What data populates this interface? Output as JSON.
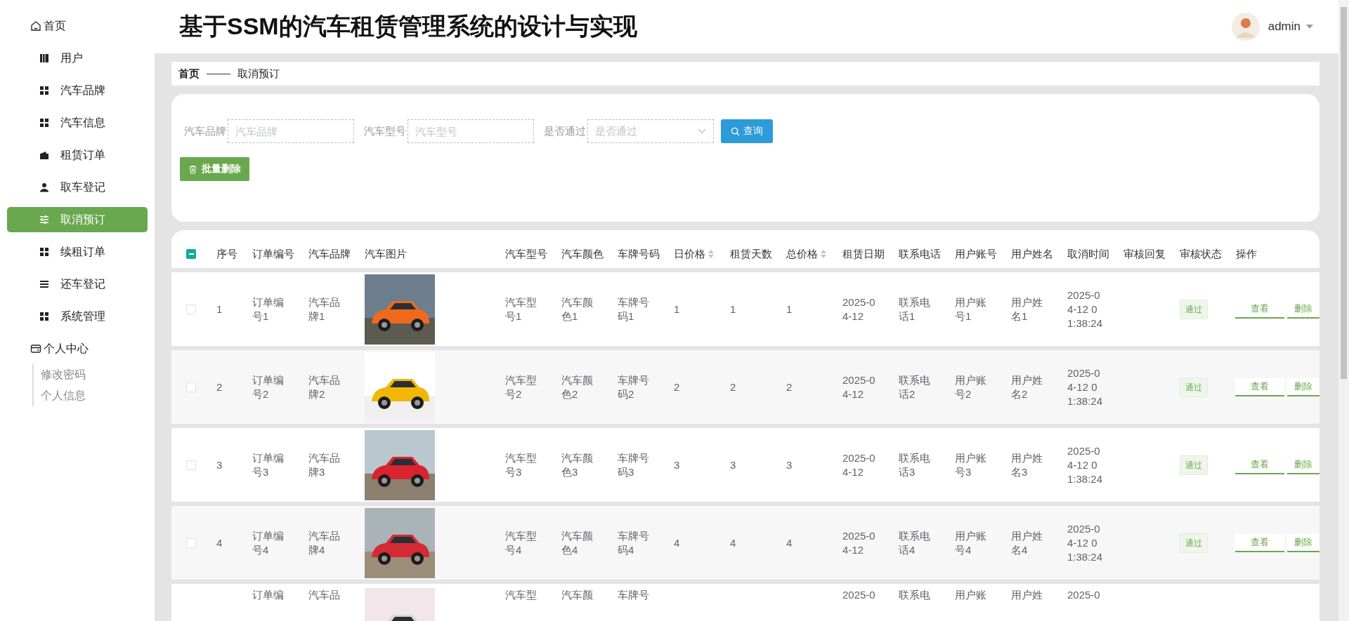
{
  "sidebar": {
    "items": [
      {
        "label": "首页",
        "kind": "top",
        "selected": false
      },
      {
        "label": "用户",
        "kind": "item",
        "selected": false
      },
      {
        "label": "汽车品牌",
        "kind": "item",
        "selected": false
      },
      {
        "label": "汽车信息",
        "kind": "item",
        "selected": false
      },
      {
        "label": "租赁订单",
        "kind": "item",
        "selected": false
      },
      {
        "label": "取车登记",
        "kind": "item",
        "selected": false
      },
      {
        "label": "取消预订",
        "kind": "item",
        "selected": true
      },
      {
        "label": "续租订单",
        "kind": "item",
        "selected": false
      },
      {
        "label": "还车登记",
        "kind": "item",
        "selected": false
      },
      {
        "label": "系统管理",
        "kind": "item",
        "selected": false
      },
      {
        "label": "个人中心",
        "kind": "top",
        "selected": false,
        "expanded": true,
        "children": [
          {
            "label": "修改密码"
          },
          {
            "label": "个人信息"
          }
        ]
      }
    ]
  },
  "header": {
    "title": "基于SSM的汽车租赁管理系统的设计与实现",
    "user": "admin"
  },
  "breadcrumb": [
    "首页",
    "取消预订"
  ],
  "search": {
    "fields": [
      {
        "label": "汽车品牌",
        "placeholder": "汽车品牌",
        "kind": "input"
      },
      {
        "label": "汽车型号",
        "placeholder": "汽车型号",
        "kind": "input"
      },
      {
        "label": "是否通过",
        "placeholder": "是否通过",
        "kind": "select"
      }
    ],
    "query_button": "查询",
    "batch_delete_button": "批量删除"
  },
  "table": {
    "select_all": {
      "indeterminate": true
    },
    "columns": [
      {
        "label": "序号"
      },
      {
        "label": "订单编号"
      },
      {
        "label": "汽车品牌"
      },
      {
        "label": "汽车图片"
      },
      {
        "label": "汽车型号"
      },
      {
        "label": "汽车颜色"
      },
      {
        "label": "车牌号码"
      },
      {
        "label": "日价格",
        "sortable": true
      },
      {
        "label": "租赁天数"
      },
      {
        "label": "总价格",
        "sortable": true
      },
      {
        "label": "租赁日期"
      },
      {
        "label": "联系电话"
      },
      {
        "label": "用户账号"
      },
      {
        "label": "用户姓名"
      },
      {
        "label": "取消时间"
      },
      {
        "label": "审核回复"
      },
      {
        "label": "审核状态"
      },
      {
        "label": "操作"
      }
    ],
    "rows": [
      {
        "checked": false,
        "cells": [
          "1",
          "订单编号1",
          "汽车品牌1",
          {
            "kind": "picture"
          },
          "汽车型号1",
          "汽车颜色1",
          "车牌号码1",
          "1",
          "1",
          "1",
          "2025-04-12",
          "联系电话1",
          "用户账号1",
          "用户姓名1",
          "2025-04-12 01:38:24"
        ],
        "status": "通过",
        "actions": [
          "查看",
          "删除"
        ]
      },
      {
        "checked": false,
        "cells": [
          "2",
          "订单编号2",
          "汽车品牌2",
          {
            "kind": "picture"
          },
          "汽车型号2",
          "汽车颜色2",
          "车牌号码2",
          "2",
          "2",
          "2",
          "2025-04-12",
          "联系电话2",
          "用户账号2",
          "用户姓名2",
          "2025-04-12 01:38:24"
        ],
        "status": "通过",
        "actions": [
          "查看",
          "删除"
        ]
      },
      {
        "checked": false,
        "cells": [
          "3",
          "订单编号3",
          "汽车品牌3",
          {
            "kind": "picture"
          },
          "汽车型号3",
          "汽车颜色3",
          "车牌号码3",
          "3",
          "3",
          "3",
          "2025-04-12",
          "联系电话3",
          "用户账号3",
          "用户姓名3",
          "2025-04-12 01:38:24"
        ],
        "status": "通过",
        "actions": [
          "查看",
          "删除"
        ]
      },
      {
        "checked": false,
        "cells": [
          "4",
          "订单编号4",
          "汽车品牌4",
          {
            "kind": "picture"
          },
          "汽车型号4",
          "汽车颜色4",
          "车牌号码4",
          "4",
          "4",
          "4",
          "2025-04-12",
          "联系电话4",
          "用户账号4",
          "用户姓名4",
          "2025-04-12 01:38:24"
        ],
        "status": "通过",
        "actions": [
          "查看",
          "删除"
        ]
      },
      {
        "cells": [
          "",
          "订单编",
          "汽车品",
          {
            "kind": "picture"
          },
          "汽车型",
          "汽车颜",
          "车牌号",
          "",
          "",
          "",
          "2025-0",
          "联系电",
          "用户账",
          "用户姓",
          "2025-0"
        ]
      }
    ]
  }
}
